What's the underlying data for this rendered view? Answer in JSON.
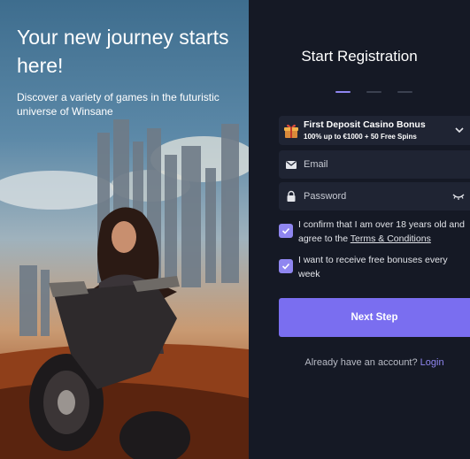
{
  "hero": {
    "title": "Your new journey starts here!",
    "subtitle": "Discover a variety of games in the futuristic universe of Winsane"
  },
  "panel": {
    "title": "Start Registration",
    "steps": [
      {
        "active": true
      },
      {
        "active": false
      },
      {
        "active": false
      }
    ]
  },
  "bonus": {
    "icon": "gift-icon",
    "title": "First Deposit Casino Bonus",
    "subtitle": "100% up to €1000 + 50 Free Spins"
  },
  "form": {
    "email_placeholder": "Email",
    "password_placeholder": "Password"
  },
  "checks": {
    "age_text_before": "I confirm that I am over 18 years old and agree to the ",
    "age_link": "Terms & Conditions",
    "age_checked": true,
    "bonus_text": "I want to receive free bonuses every week",
    "bonus_checked": true
  },
  "actions": {
    "next_label": "Next Step",
    "have_account": "Already have an account?",
    "login_label": "Login"
  },
  "colors": {
    "accent": "#7a6ef0",
    "panel_bg": "#151925",
    "field_bg": "#1f2433"
  }
}
